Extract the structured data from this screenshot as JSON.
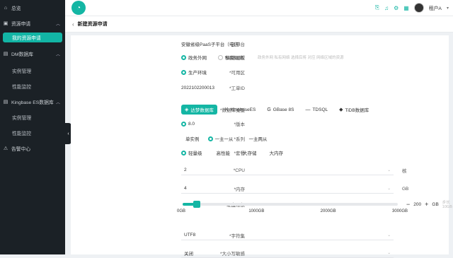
{
  "sidebar": {
    "items": [
      {
        "label": "总览",
        "icon": "home-icon",
        "type": "top"
      },
      {
        "label": "资源申请",
        "icon": "apply-icon",
        "type": "top",
        "expanded": true
      },
      {
        "label": "我的资源申请",
        "type": "sub",
        "active": true
      },
      {
        "label": "DM数据库",
        "icon": "database-icon",
        "type": "top",
        "expanded": true
      },
      {
        "label": "实例管理",
        "type": "sub"
      },
      {
        "label": "性能监控",
        "type": "sub"
      },
      {
        "label": "Kingbase ES数据库",
        "icon": "database-icon",
        "type": "top",
        "expanded": true
      },
      {
        "label": "实例管理",
        "type": "sub"
      },
      {
        "label": "性能监控",
        "type": "sub"
      },
      {
        "label": "告警中心",
        "icon": "alert-icon",
        "type": "top"
      }
    ]
  },
  "topbar": {
    "user_name": "租户A"
  },
  "header": {
    "title": "新建资源申请"
  },
  "form": {
    "cloud_platform": {
      "label": "云平台",
      "value": "安徽省级PaaS子平台（电信）"
    },
    "network": {
      "label": "*网络区域",
      "options": [
        "政务外网",
        "私有网络"
      ],
      "selected": 0,
      "hint": "政务外网 私有网络 选择后将 对应 网络区域的资源"
    },
    "zone": {
      "label": "*可用区",
      "options": [
        "生产环境"
      ],
      "selected": 0
    },
    "ticket": {
      "label": "*工单ID",
      "value": "2022102200013"
    },
    "db_type": {
      "label": "*数据库类型",
      "options": [
        "达梦数据库",
        "KingbaseES",
        "GBase 8S",
        "TDSQL",
        "TiDB数据库"
      ],
      "selected": 0
    },
    "version": {
      "label": "*版本",
      "value": "8.0"
    },
    "series": {
      "label": "*系列",
      "options": [
        "单实例",
        "一主一从",
        "一主两从"
      ],
      "selected": 1
    },
    "spec": {
      "label": "*套餐",
      "options": [
        "轻量级",
        "高性能",
        "大存储",
        "大内存"
      ],
      "selected": 0
    },
    "cpu": {
      "label": "*CPU",
      "value": "2",
      "unit": "核"
    },
    "memory": {
      "label": "*内存",
      "value": "4",
      "unit": "GB"
    },
    "disk": {
      "label": "*硬盘限额",
      "value": 200,
      "min": 0,
      "max": 3000,
      "ticks": [
        "0GB",
        "1000GB",
        "2000GB",
        "3000GB"
      ],
      "unit": "GB",
      "step_hint": "步长 10GB"
    },
    "charset": {
      "label": "*字符集",
      "value": "UTF8"
    },
    "case_sensitive": {
      "label": "*大小写敏感",
      "value": "关闭"
    }
  },
  "colors": {
    "accent": "#14b6a4",
    "sidebar_bg": "#1b2126"
  }
}
